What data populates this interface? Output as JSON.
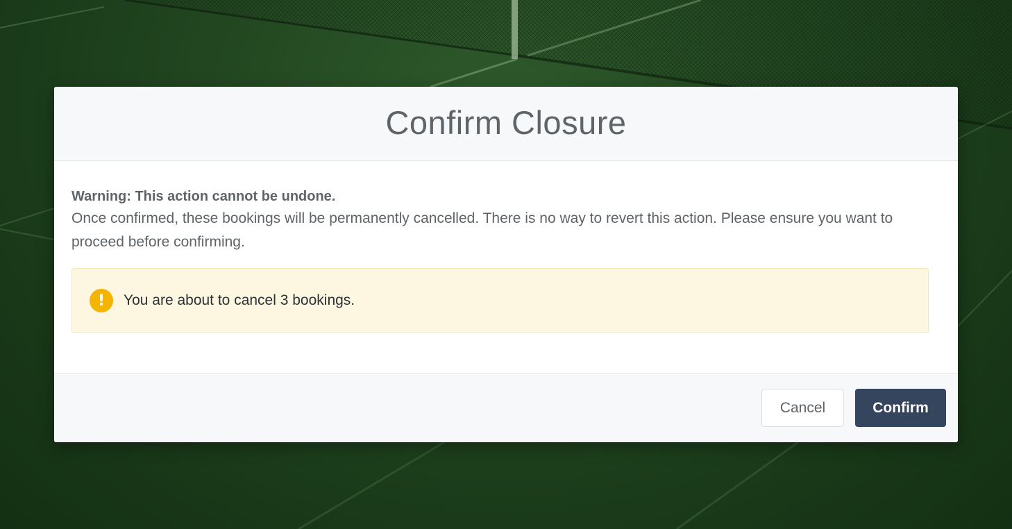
{
  "modal": {
    "title": "Confirm Closure",
    "warning_heading": "Warning: This action cannot be undone.",
    "warning_text": "Once confirmed, these bookings will be permanently cancelled. There is no way to revert this action. Please ensure you want to proceed before confirming.",
    "alert": {
      "icon": "exclamation-icon",
      "icon_glyph": "!",
      "text": "You are about to cancel 3 bookings."
    },
    "buttons": {
      "cancel_label": "Cancel",
      "confirm_label": "Confirm"
    }
  },
  "colors": {
    "confirm_button": "#34455d",
    "alert_background": "#fdf6e1",
    "alert_icon": "#f5b400",
    "background": "#244a22"
  }
}
